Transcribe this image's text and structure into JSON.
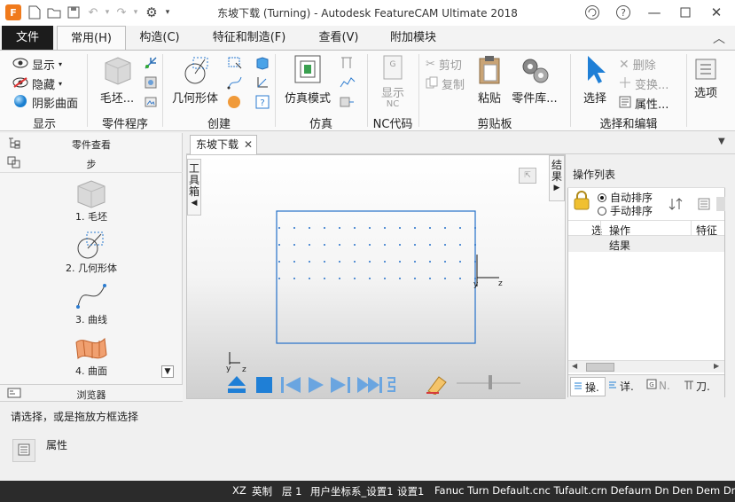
{
  "window": {
    "title": "东坡下载 (Turning) - Autodesk FeatureCAM Ultimate 2018"
  },
  "tabs": {
    "file": "文件",
    "common": "常用(H)",
    "construct": "构造(C)",
    "features": "特征和制造(F)",
    "view": "查看(V)",
    "addons": "附加模块"
  },
  "ribbon": {
    "display": {
      "show": "显示",
      "hide": "隐藏",
      "shaded": "阴影曲面",
      "group": "显示"
    },
    "part": {
      "stock": "毛坯...",
      "group": "零件程序"
    },
    "create": {
      "geometry": "几何形体",
      "group": "创建"
    },
    "simulation": {
      "mode": "仿真模式",
      "group": "仿真"
    },
    "nc": {
      "show": "显示",
      "nc_small": "NC",
      "group": "NC代码"
    },
    "clipboard": {
      "cut": "剪切",
      "copy": "复制",
      "paste": "粘贴",
      "library": "零件库...",
      "group": "剪贴板"
    },
    "select_edit": {
      "select": "选择",
      "delete": "删除",
      "transform": "变换...",
      "properties": "属性...",
      "group": "选择和编辑"
    },
    "options": {
      "label": "选项"
    }
  },
  "left_panel": {
    "part_view": "零件查看",
    "steps_header": "步",
    "steps": [
      "1. 毛坯",
      "2. 几何形体",
      "3. 曲线",
      "4. 曲面"
    ],
    "browser": "浏览器"
  },
  "document": {
    "tab": "东坡下载"
  },
  "viewport": {
    "toolbox": [
      "工",
      "具",
      "箱"
    ],
    "results": [
      "结",
      "果"
    ],
    "axis": {
      "x": "z",
      "y": "y"
    }
  },
  "op_panel": {
    "title": "操作列表",
    "auto_sort": "自动排序",
    "manual_sort": "手动排序",
    "col_sel": "选",
    "col_op": "操作",
    "col_feature": "特征",
    "row_result": "结果",
    "bottom_tabs": [
      "操.",
      "详.",
      "N.",
      "刀."
    ]
  },
  "bottom": {
    "prompt": "请选择，或是拖放方框选择",
    "properties": "属性"
  },
  "status": {
    "plane": "XZ",
    "units": "英制",
    "layer": "层 1",
    "ucs": "用户坐标系_设置1",
    "setup": "设置1",
    "post": "Fanuc Turn Default.cnc Tufault.crn Defaurn Dn Den Dem Dn Den"
  },
  "colors": {
    "accent": "#1f7fd6",
    "file_tab": "#1c1c1c",
    "status": "#2b2b2b"
  }
}
